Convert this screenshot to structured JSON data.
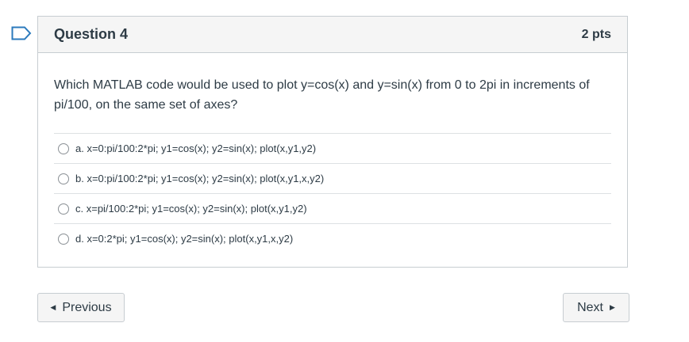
{
  "question": {
    "title": "Question 4",
    "points": "2 pts",
    "text": "Which MATLAB code would be used to plot y=cos(x) and y=sin(x) from 0 to 2pi in increments of pi/100, on the same set of axes?",
    "answers": [
      {
        "label": "a. x=0:pi/100:2*pi; y1=cos(x); y2=sin(x); plot(x,y1,y2)",
        "selected": false
      },
      {
        "label": "b. x=0:pi/100:2*pi; y1=cos(x); y2=sin(x); plot(x,y1,x,y2)",
        "selected": false
      },
      {
        "label": "c. x=pi/100:2*pi; y1=cos(x); y2=sin(x); plot(x,y1,y2)",
        "selected": false
      },
      {
        "label": "d. x=0:2*pi; y1=cos(x); y2=sin(x); plot(x,y1,x,y2)",
        "selected": false
      }
    ]
  },
  "navigation": {
    "previous_label": "Previous",
    "next_label": "Next"
  },
  "icons": {
    "flag": "bookmark-flag-icon",
    "previous": "triangle-left-icon",
    "next": "triangle-right-icon"
  },
  "colors": {
    "flag": "#2b7abc",
    "text": "#2d3b45",
    "header_bg": "#f5f5f5",
    "border": "#c7cdd1"
  }
}
